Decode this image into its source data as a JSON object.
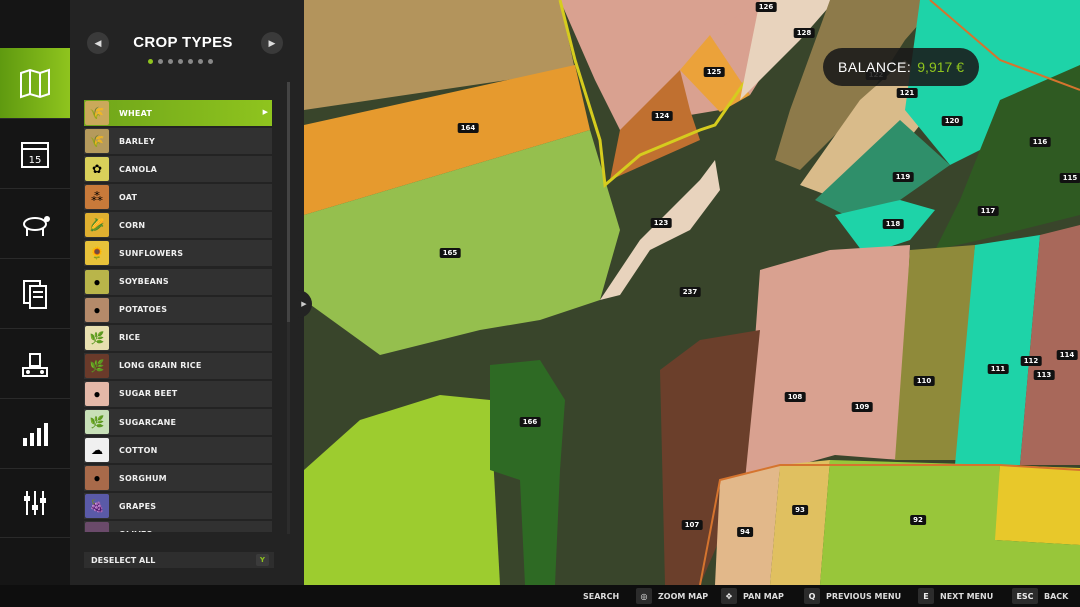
{
  "panel": {
    "title": "CROP TYPES",
    "prev_icon": "chevron-left-icon",
    "next_icon": "chevron-right-icon",
    "page_dots": 7,
    "active_dot": 0,
    "crops": [
      {
        "label": "WHEAT",
        "selected": true,
        "color": "#caa95a",
        "icon": "🌾"
      },
      {
        "label": "BARLEY",
        "color": "#b59a5c",
        "icon": "🌾"
      },
      {
        "label": "CANOLA",
        "color": "#d9d05a",
        "icon": "✿"
      },
      {
        "label": "OAT",
        "color": "#c87a3a",
        "icon": "⁂"
      },
      {
        "label": "CORN",
        "color": "#e0b030",
        "icon": "🌽"
      },
      {
        "label": "SUNFLOWERS",
        "color": "#e8c23a",
        "icon": "🌻"
      },
      {
        "label": "SOYBEANS",
        "color": "#b9b54a",
        "icon": "●"
      },
      {
        "label": "POTATOES",
        "color": "#b58a6a",
        "icon": "●"
      },
      {
        "label": "RICE",
        "color": "#e8e0b0",
        "icon": "🌿"
      },
      {
        "label": "LONG GRAIN RICE",
        "color": "#6a3a2a",
        "icon": "🌿"
      },
      {
        "label": "SUGAR BEET",
        "color": "#e4b8a8",
        "icon": "●"
      },
      {
        "label": "SUGARCANE",
        "color": "#c8e0b8",
        "icon": "🌿"
      },
      {
        "label": "COTTON",
        "color": "#f0f0f0",
        "icon": "☁"
      },
      {
        "label": "SORGHUM",
        "color": "#a86a4a",
        "icon": "●"
      },
      {
        "label": "GRAPES",
        "color": "#5a5aa8",
        "icon": "🍇"
      },
      {
        "label": "OLIVES",
        "color": "#6a4a6a",
        "icon": "●"
      }
    ],
    "deselect_label": "DESELECT ALL",
    "deselect_key": "Y"
  },
  "rail": {
    "items": [
      {
        "name": "map-icon",
        "active": true
      },
      {
        "name": "calendar-icon",
        "label": "15"
      },
      {
        "name": "cow-icon"
      },
      {
        "name": "documents-icon"
      },
      {
        "name": "production-icon"
      },
      {
        "name": "statistics-icon"
      },
      {
        "name": "settings-icon"
      }
    ]
  },
  "balance": {
    "label": "BALANCE:",
    "value": "9,917 €"
  },
  "map": {
    "field_labels": [
      "126",
      "128",
      "125",
      "124",
      "122",
      "121",
      "120",
      "116",
      "115",
      "164",
      "119",
      "117",
      "123",
      "118",
      "165",
      "237",
      "112",
      "114",
      "113",
      "111",
      "110",
      "108",
      "109",
      "166",
      "93",
      "92",
      "94",
      "107"
    ]
  },
  "bottom_bar": {
    "hints": [
      {
        "label": "SEARCH"
      },
      {
        "label": "ZOOM MAP",
        "icon": "mouse-wheel-icon"
      },
      {
        "label": "PAN MAP",
        "icon": "mouse-drag-icon"
      },
      {
        "key": "Q",
        "label": "PREVIOUS MENU"
      },
      {
        "key": "E",
        "label": "NEXT MENU"
      },
      {
        "key": "ESC",
        "label": "BACK"
      }
    ]
  }
}
